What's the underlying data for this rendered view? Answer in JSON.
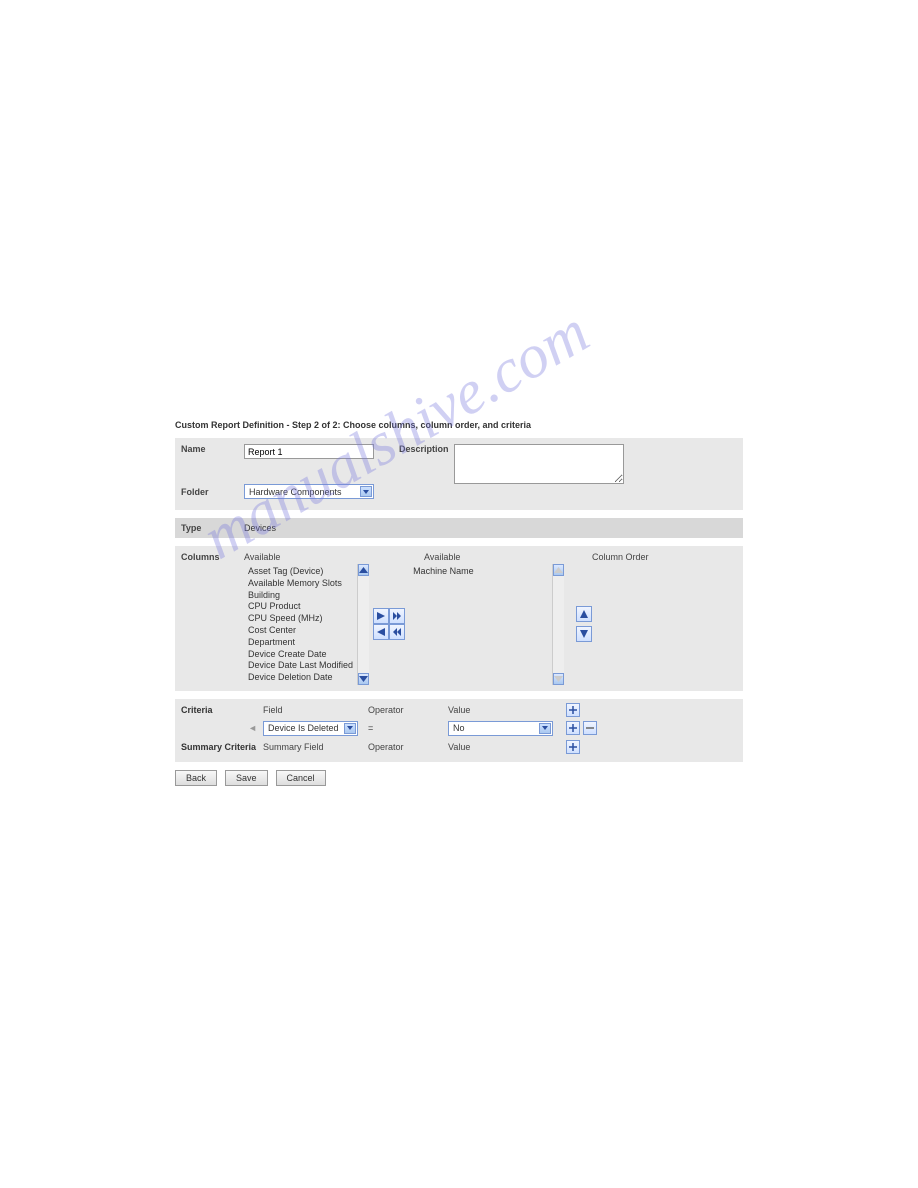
{
  "title": "Custom Report Definition - Step 2 of 2: Choose columns, column order, and criteria",
  "form": {
    "name_label": "Name",
    "name_value": "Report 1",
    "folder_label": "Folder",
    "folder_value": "Hardware Components",
    "description_label": "Description",
    "description_value": ""
  },
  "type": {
    "label": "Type",
    "value": "Devices"
  },
  "columns": {
    "label": "Columns",
    "available_header": "Available",
    "selected_header": "Available",
    "order_header": "Column Order",
    "available_items": [
      "Asset Tag (Device)",
      "Available Memory Slots",
      "Building",
      "CPU Product",
      "CPU Speed (MHz)",
      "Cost Center",
      "Department",
      "Device Create Date",
      "Device Date Last Modified",
      "Device Deletion Date"
    ],
    "selected_items": [
      "Machine Name"
    ]
  },
  "criteria": {
    "label": "Criteria",
    "field_header": "Field",
    "operator_header": "Operator",
    "value_header": "Value",
    "field_value": "Device Is Deleted",
    "operator_value": "=",
    "value_value": "No"
  },
  "summary": {
    "label": "Summary Criteria",
    "field_header": "Summary Field",
    "operator_header": "Operator",
    "value_header": "Value"
  },
  "buttons": {
    "back": "Back",
    "save": "Save",
    "cancel": "Cancel"
  }
}
